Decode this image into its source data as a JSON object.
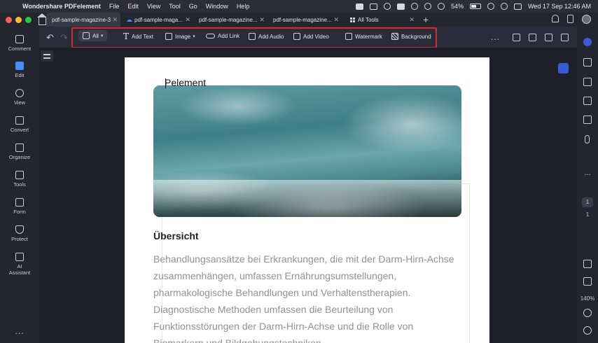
{
  "menubar": {
    "app_name": "Wondershare PDFelement",
    "menu_items": [
      "File",
      "Edit",
      "View",
      "Tool",
      "Go",
      "Window",
      "Help"
    ],
    "battery": "54%",
    "datetime": "Wed 17 Sep  12:46 AM"
  },
  "tabs": [
    {
      "label": "pdf-sample-magazine-3",
      "active": true
    },
    {
      "label": "pdf-sample-maga...",
      "cloud": true
    },
    {
      "label": "pdf-sample-magazine..."
    },
    {
      "label": "pdf-sample-magazine..."
    },
    {
      "label": "All Tools"
    }
  ],
  "sidebar": {
    "items": [
      {
        "label": "Comment"
      },
      {
        "label": "Edit"
      },
      {
        "label": "View"
      },
      {
        "label": "Convert"
      },
      {
        "label": "Organize"
      },
      {
        "label": "Tools"
      },
      {
        "label": "Form"
      },
      {
        "label": "Protect"
      },
      {
        "label": "AI",
        "label2": "Assistant"
      }
    ],
    "more": "..."
  },
  "toolbar": {
    "all_label": "All",
    "add_text": "Add Text",
    "image": "Image",
    "add_link": "Add Link",
    "add_audio": "Add Audio",
    "add_video": "Add Video",
    "watermark": "Watermark",
    "background": "Background",
    "more": "..."
  },
  "document": {
    "floating_title": "Pelement",
    "heading": "Übersicht",
    "body_lines": [
      "Behandlungsansätze bei Erkrankungen, die mit der Darm-Hirn-Achse",
      "zusammenhängen, umfassen Ernährungsumstellungen,",
      "pharmakologische Behandlungen und Verhaltenstherapien.",
      "Diagnostische Methoden umfassen die Beurteilung von",
      "Funktionsstörungen der Darm-Hirn-Achse und die Rolle von",
      "Biomarkern und Bildgebungstechniken."
    ]
  },
  "rightbar": {
    "page_current": "1",
    "page_total": "1",
    "zoom": "140%",
    "more": "..."
  },
  "colors": {
    "accent": "#4a8bf5",
    "highlight_border": "#e0242c",
    "body_text": "#8f9297"
  }
}
